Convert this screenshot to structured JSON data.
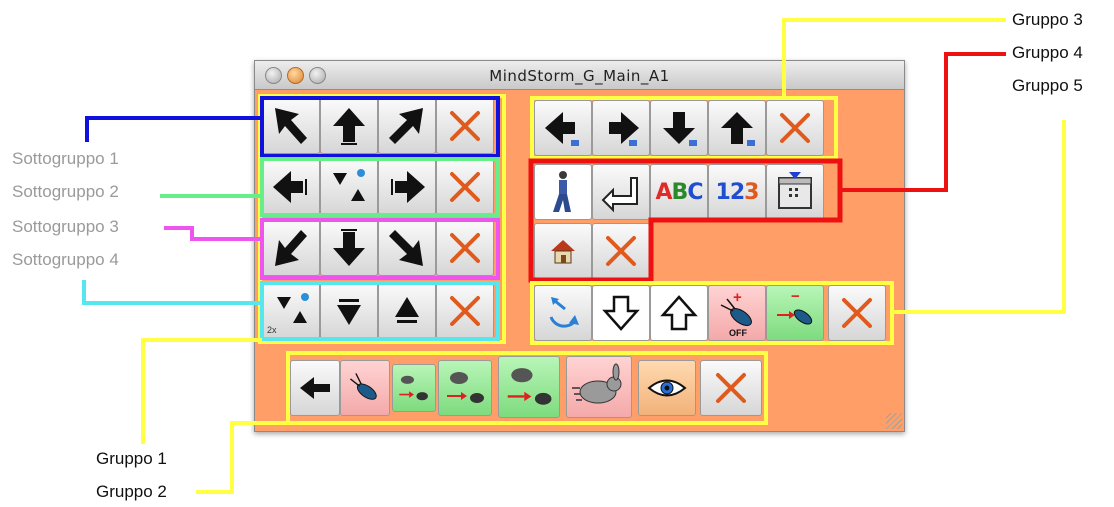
{
  "window": {
    "title": "MindStorm_G_Main_A1"
  },
  "labels": {
    "sottogruppo_1": "Sottogruppo 1",
    "sottogruppo_2": "Sottogruppo 2",
    "sottogruppo_3": "Sottogruppo 3",
    "sottogruppo_4": "Sottogruppo 4",
    "gruppo_1": "Gruppo 1",
    "gruppo_2": "Gruppo 2",
    "gruppo_3": "Gruppo 3",
    "gruppo_4": "Gruppo 4",
    "gruppo_5": "Gruppo 5"
  },
  "buttons": {
    "abc": "ABC",
    "num": "123",
    "off": "OFF",
    "plus": "+",
    "minus": "−",
    "two_x": "2x"
  },
  "colors": {
    "window_bg": "#ff9e66",
    "gruppo_1": "#ffff44",
    "gruppo_2": "#ffff44",
    "gruppo_3": "#ffff44",
    "gruppo_4": "#ee1111",
    "gruppo_5": "#ffff44",
    "sottogruppo_1": "#1111dd",
    "sottogruppo_2": "#66ee88",
    "sottogruppo_3": "#ee55ee",
    "sottogruppo_4": "#55e6ee",
    "cancel_x": "#e05a1e"
  }
}
